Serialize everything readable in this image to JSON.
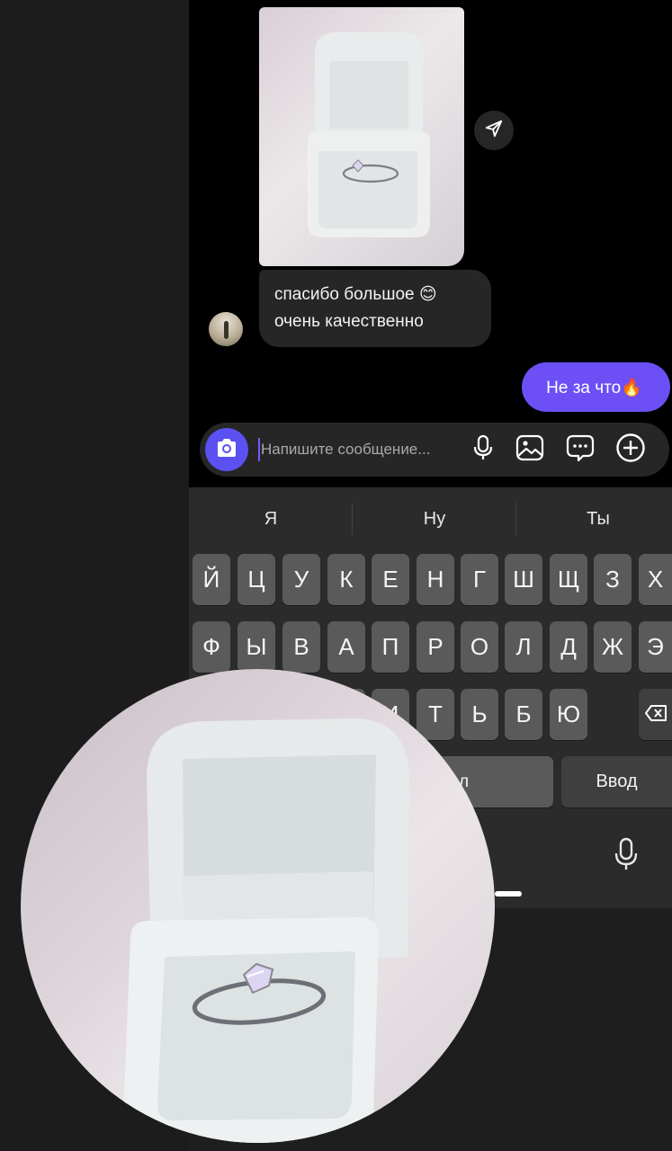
{
  "chat": {
    "received_lines": [
      "спасибо большое 😊",
      "очень качественно"
    ],
    "sent_text": "Не за что🔥"
  },
  "composer": {
    "placeholder": "Напишите сообщение..."
  },
  "keyboard": {
    "suggestions": [
      "Я",
      "Ну",
      "Ты"
    ],
    "row1": [
      "Й",
      "Ц",
      "У",
      "К",
      "Е",
      "Н",
      "Г",
      "Ш",
      "Щ",
      "З",
      "Х"
    ],
    "row2": [
      "Ф",
      "Ы",
      "В",
      "А",
      "П",
      "Р",
      "О",
      "Л",
      "Д",
      "Ж",
      "Э"
    ],
    "row3": [
      "И",
      "Т",
      "Ь",
      "Б",
      "Ю"
    ],
    "row3_partial": "М",
    "space_partial": "л",
    "enter_label": "Ввод"
  },
  "icons": {
    "share": "send-icon",
    "camera": "camera-icon",
    "mic": "microphone-icon",
    "gallery": "image-icon",
    "sticker": "chat-bubble-icon",
    "add": "plus-circle-icon",
    "backspace": "backspace-icon",
    "keyboard_mic": "microphone-icon"
  },
  "colors": {
    "accent": "#6c4ff5",
    "camera_button": "#5b51f1",
    "received_bubble": "#262626",
    "keyboard_bg": "#2b2b2b",
    "key_bg": "#5a5a5a"
  }
}
